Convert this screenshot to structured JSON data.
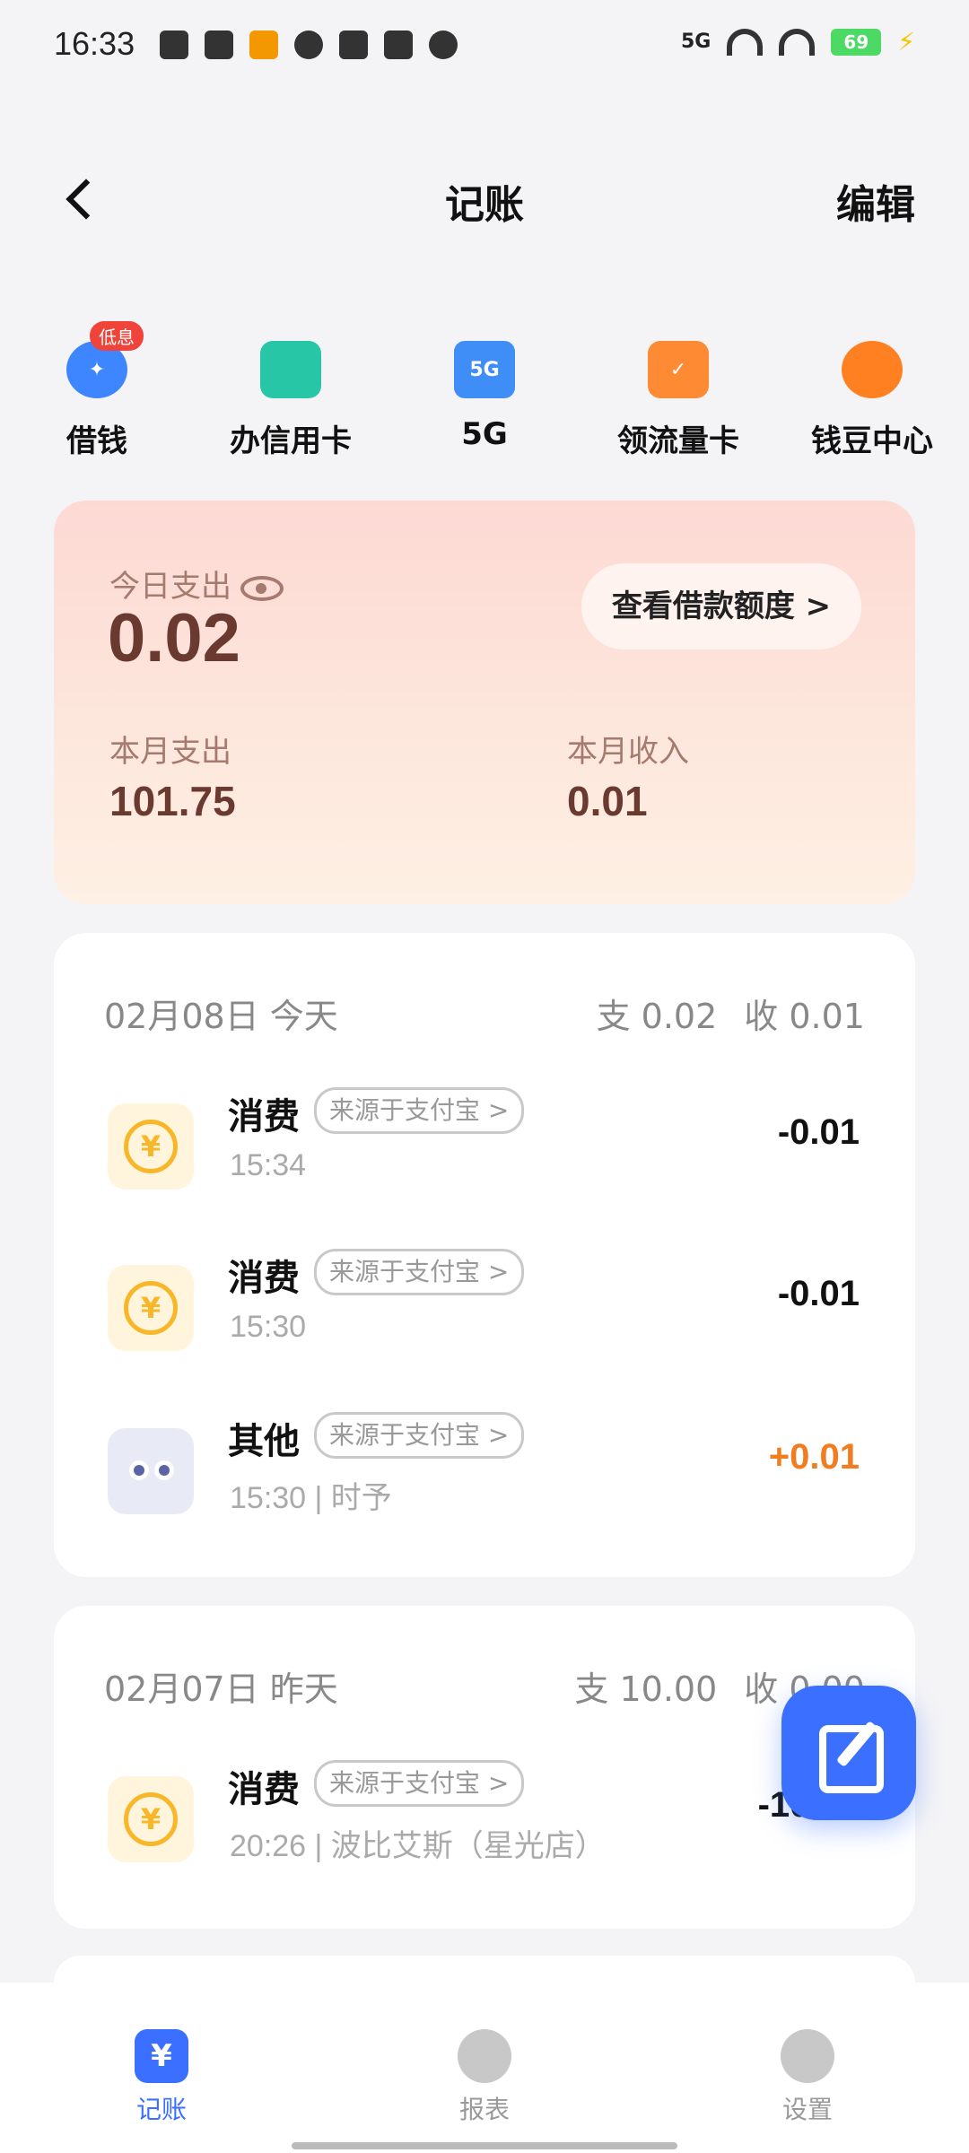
{
  "status_bar": {
    "time": "16:33",
    "network": "5G",
    "battery": "69"
  },
  "nav": {
    "title": "记账",
    "edit_label": "编辑"
  },
  "shortcuts": [
    {
      "label": "借钱",
      "icon": "sparkle-icon",
      "badge": "低息"
    },
    {
      "label": "办信用卡",
      "icon": "credit-card-icon"
    },
    {
      "label": "5G",
      "icon": "5g-icon",
      "icon_text": "5G"
    },
    {
      "label": "领流量卡",
      "icon": "sim-card-icon"
    },
    {
      "label": "钱豆中心",
      "icon": "bean-icon"
    }
  ],
  "summary": {
    "today_label": "今日支出",
    "today_value": "0.02",
    "loan_button": "查看借款额度 >",
    "month_expense_label": "本月支出",
    "month_expense_value": "101.75",
    "month_income_label": "本月收入",
    "month_income_value": "0.01"
  },
  "days": [
    {
      "date": "02月08日 今天",
      "expense": "支 0.02",
      "income": "收 0.01",
      "transactions": [
        {
          "title": "消费",
          "source": "来源于支付宝 >",
          "time": "15:34",
          "amount": "-0.01",
          "icon": "yuan-coin-icon"
        },
        {
          "title": "消费",
          "source": "来源于支付宝 >",
          "time": "15:30",
          "amount": "-0.01",
          "icon": "yuan-coin-icon"
        },
        {
          "title": "其他",
          "source": "来源于支付宝 >",
          "time": "15:30 | 时予",
          "amount": "+0.01",
          "icon": "other-icon"
        }
      ]
    },
    {
      "date": "02月07日 昨天",
      "expense": "支 10.00",
      "income": "收 0.00",
      "transactions": [
        {
          "title": "消费",
          "source": "来源于支付宝 >",
          "time": "20:26 | 波比艾斯（星光店）",
          "amount": "-10.00",
          "icon": "yuan-coin-icon"
        }
      ]
    }
  ],
  "tabs": [
    {
      "label": "记账",
      "icon": "ledger-icon",
      "active": true
    },
    {
      "label": "报表",
      "icon": "pie-chart-icon"
    },
    {
      "label": "设置",
      "icon": "settings-icon"
    }
  ],
  "colors": {
    "accent": "#3a6fff",
    "income": "#f07d1f",
    "card_gradient_top": "#fdd9d4"
  }
}
